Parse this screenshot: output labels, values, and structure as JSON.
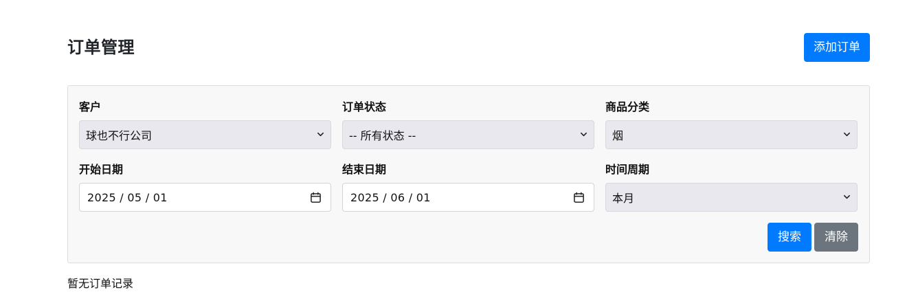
{
  "header": {
    "title": "订单管理",
    "add_button": "添加订单"
  },
  "filters": {
    "customer": {
      "label": "客户",
      "value": "球也不行公司",
      "icon": "chevron-down-icon"
    },
    "status": {
      "label": "订单状态",
      "value": "-- 所有状态 --",
      "icon": "chevron-down-icon"
    },
    "category": {
      "label": "商品分类",
      "value": "烟",
      "icon": "chevron-down-icon"
    },
    "start_date": {
      "label": "开始日期",
      "value": "2025 / 05 / 01",
      "icon": "calendar-icon"
    },
    "end_date": {
      "label": "结束日期",
      "value": "2025 / 06 / 01",
      "icon": "calendar-icon"
    },
    "period": {
      "label": "时间周期",
      "value": "本月",
      "icon": "chevron-down-icon"
    }
  },
  "actions": {
    "search": "搜索",
    "clear": "清除"
  },
  "empty_message": "暂无订单记录",
  "colors": {
    "primary": "#007bff",
    "secondary": "#6c757d",
    "panel": "#f8f8f8",
    "select_bg": "#e8e8ee"
  }
}
